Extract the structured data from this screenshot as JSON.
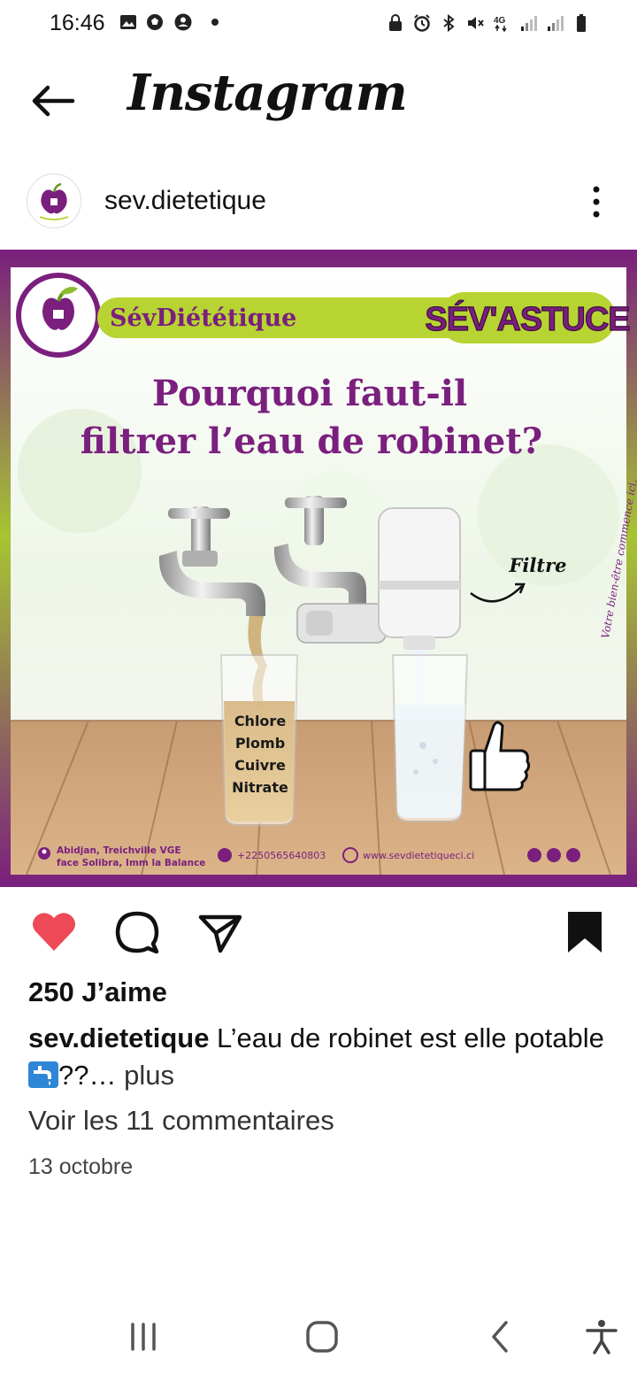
{
  "status_bar": {
    "time": "16:46",
    "icons_left": [
      "gallery-icon",
      "soccer-ball-icon",
      "account-icon",
      "dot-icon"
    ],
    "icons_right": [
      "lock-icon",
      "alarm-icon",
      "bluetooth-icon",
      "mute-icon",
      "4g-icon",
      "signal-icon",
      "signal-icon",
      "battery-icon"
    ]
  },
  "app_bar": {
    "back_icon": "arrow-left-icon",
    "title": "Instagram"
  },
  "post": {
    "username": "sev.dietetique",
    "more_icon": "more-vertical-icon",
    "image": {
      "brand": "SévDiététique",
      "tag": "SÉV'ASTUCE",
      "headline_line1": "Pourquoi faut-il",
      "headline_line2": "filtrer l’eau de robinet?",
      "contaminants": [
        "Chlore",
        "Plomb",
        "Cuivre",
        "Nitrate"
      ],
      "filter_label": "Filtre",
      "side_text": "Votre bien-être commence ici.",
      "address_line1": "Abidjan, Treichville VGE",
      "address_line2": "face Solibra, Imm la Balance",
      "phone": "+2250565640803",
      "website": "www.sevdietetiqueci.ci"
    },
    "actions": {
      "like_icon": "heart-filled-icon",
      "comment_icon": "comment-icon",
      "share_icon": "send-icon",
      "save_icon": "bookmark-filled-icon"
    },
    "likes": "250 J’aime",
    "caption_username": "sev.dietetique",
    "caption_text": " L’eau de robinet est elle potable",
    "caption_line2": "??…",
    "caption_more": " plus",
    "comments_link": "Voir les 11 commentaires",
    "date": "13 octobre"
  },
  "nav_bar": {
    "icons": [
      "recent-apps-icon",
      "home-icon",
      "back-icon",
      "accessibility-icon"
    ]
  },
  "colors": {
    "purple": "#7a1f7e",
    "lime": "#b8d432",
    "like_red": "#ed4956"
  }
}
